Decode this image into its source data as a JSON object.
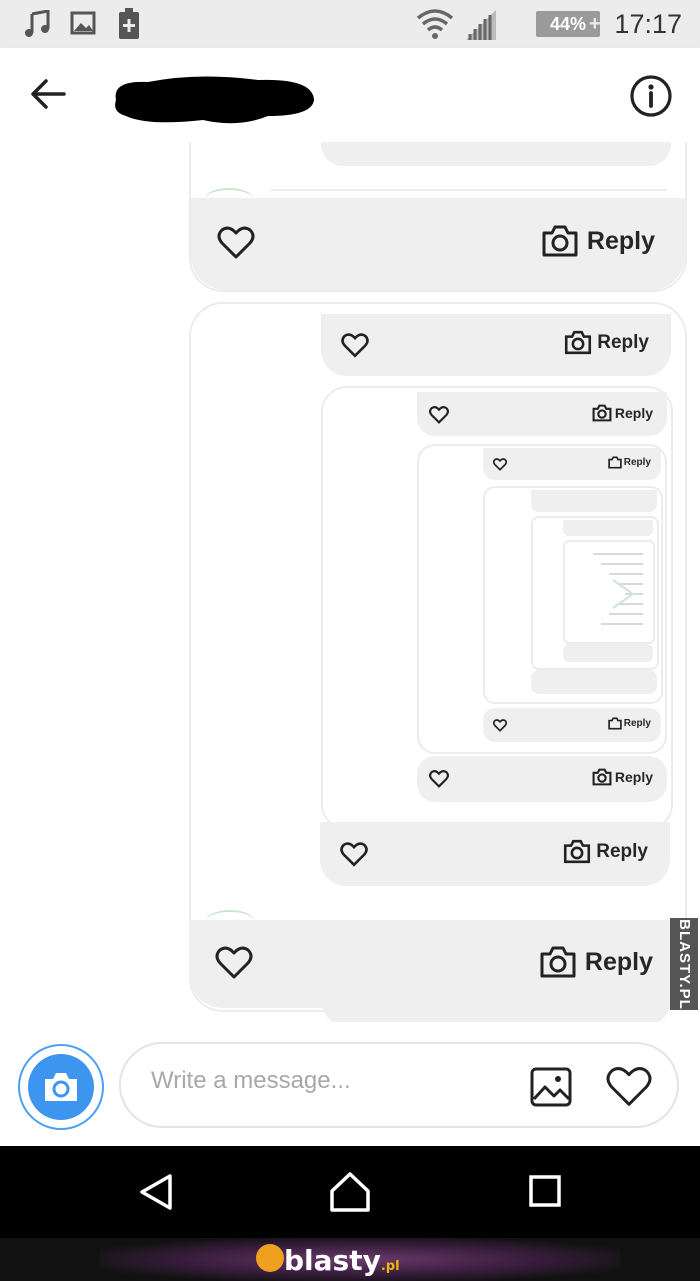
{
  "status_bar": {
    "battery": "44%",
    "time": "17:17",
    "icons": [
      "music-note-icon",
      "image-icon",
      "battery-saver-icon",
      "wifi-icon",
      "signal-icon",
      "battery-icon"
    ]
  },
  "header": {
    "back_icon": "arrow-left-icon",
    "contact_name": "",
    "info_icon": "info-icon"
  },
  "story_reply": {
    "reply_label": "Reply",
    "like_icon": "heart-icon",
    "camera_icon": "camera-icon"
  },
  "composer": {
    "placeholder": "Write a message...",
    "camera_icon": "camera-icon",
    "gallery_icon": "gallery-icon",
    "like_icon": "heart-icon"
  },
  "navigation": {
    "icons": [
      "nav-back-icon",
      "nav-home-icon",
      "nav-recent-apps-icon"
    ]
  },
  "watermark": {
    "side_text": "BLASTY.PL",
    "brand": "blasty",
    "brand_suffix": ".pl"
  },
  "colors": {
    "accent": "#3d95f0",
    "bubble_gray": "#efefef",
    "navbar": "#000000"
  }
}
